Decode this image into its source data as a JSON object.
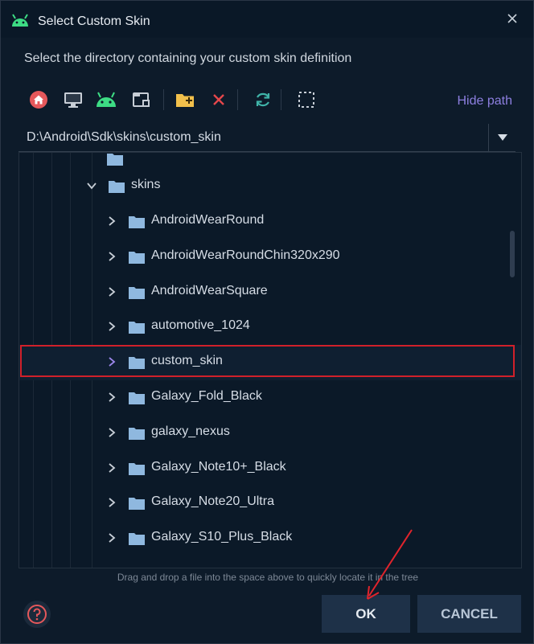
{
  "window": {
    "title": "Select Custom Skin",
    "icon": "android-icon"
  },
  "subtitle": "Select the directory containing your custom skin definition",
  "toolbar": {
    "buttons": [
      "home-icon",
      "desktop-icon",
      "android-icon",
      "project-icon",
      "new-folder-icon",
      "delete-icon",
      "refresh-icon",
      "select-icon"
    ],
    "hide_path_label": "Hide path"
  },
  "path": {
    "value": "D:\\Android\\Sdk\\skins\\custom_skin"
  },
  "tree": {
    "parent_folder": "skins",
    "items": [
      {
        "label": "AndroidWearRound"
      },
      {
        "label": "AndroidWearRoundChin320x290"
      },
      {
        "label": "AndroidWearSquare"
      },
      {
        "label": "automotive_1024"
      },
      {
        "label": "custom_skin",
        "selected": true
      },
      {
        "label": "Galaxy_Fold_Black"
      },
      {
        "label": "galaxy_nexus"
      },
      {
        "label": "Galaxy_Note10+_Black"
      },
      {
        "label": "Galaxy_Note20_Ultra"
      },
      {
        "label": "Galaxy_S10_Plus_Black"
      }
    ]
  },
  "hint": "Drag and drop a file into the space above to quickly locate it in the tree",
  "buttons": {
    "ok": "OK",
    "cancel": "CANCEL"
  },
  "colors": {
    "accent": "#8d7fe0",
    "selection_border": "#d0202a",
    "folder": "#8fb8df",
    "button_bg": "#1e3148"
  }
}
